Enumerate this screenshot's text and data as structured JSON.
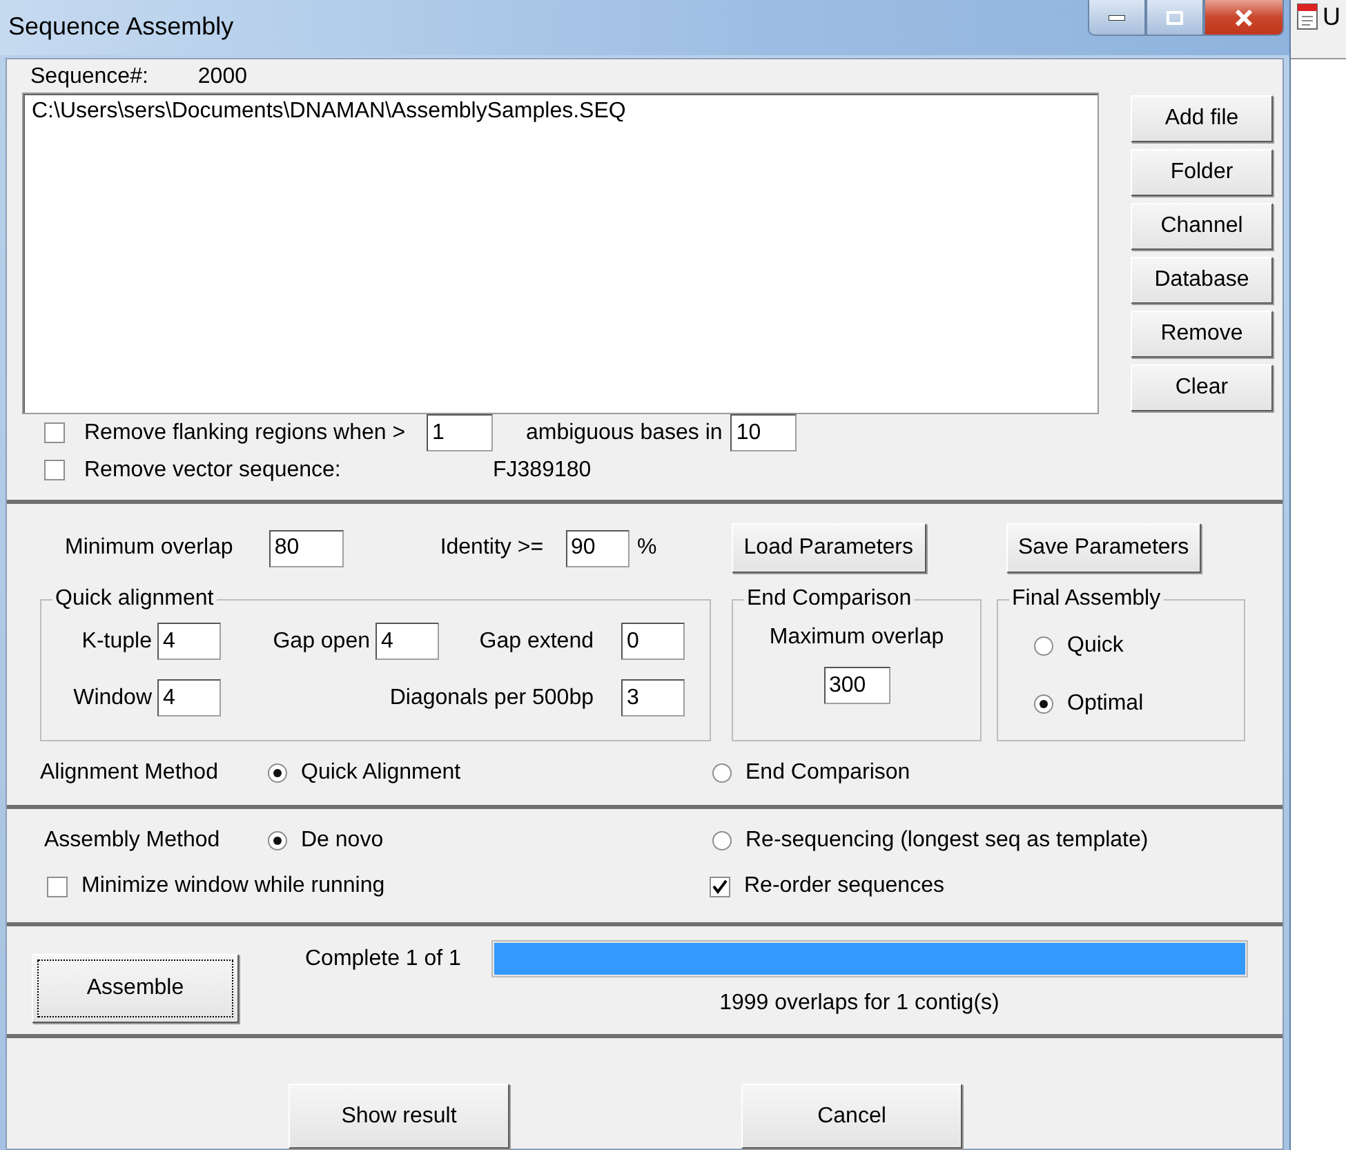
{
  "window": {
    "title": "Sequence Assembly"
  },
  "background_window": {
    "title": "U"
  },
  "sequence": {
    "label": "Sequence#:",
    "value": "2000"
  },
  "file_list": {
    "items": [
      "C:\\Users\\sers\\Documents\\DNAMAN\\AssemblySamples.SEQ"
    ]
  },
  "file_buttons": [
    "Add file",
    "Folder",
    "Channel",
    "Database",
    "Remove",
    "Clear"
  ],
  "trim": [
    {
      "checked": false,
      "label": "Remove flanking regions when >",
      "value": "1",
      "label2": "ambiguous bases in",
      "value2": "10"
    },
    {
      "checked": false,
      "label": "Remove vector sequence:",
      "note": "FJ389180"
    }
  ],
  "parameters": {
    "min_overlap": {
      "label": "Minimum overlap",
      "value": "80"
    },
    "identity": {
      "label": "Identity >=",
      "value": "90",
      "unit": "%"
    },
    "buttons": [
      "Load Parameters",
      "Save Parameters"
    ]
  },
  "quick_alignment": {
    "title": "Quick alignment",
    "fields": [
      {
        "label": "K-tuple",
        "value": "4"
      },
      {
        "label": "Gap open",
        "value": "4"
      },
      {
        "label": "Gap extend",
        "value": "0"
      },
      {
        "label": "Window",
        "value": "4"
      },
      {
        "label": "Diagonals per 500bp",
        "value": "3"
      }
    ]
  },
  "end_comparison": {
    "title": "End Comparison",
    "label": "Maximum overlap",
    "value": "300"
  },
  "final_assembly": {
    "title": "Final Assembly",
    "options": [
      {
        "label": "Quick",
        "selected": false
      },
      {
        "label": "Optimal",
        "selected": true
      }
    ]
  },
  "alignment_method": {
    "label": "Alignment Method",
    "options": [
      {
        "label": "Quick Alignment",
        "selected": true
      },
      {
        "label": "End Comparison",
        "selected": false
      }
    ]
  },
  "assembly_method": {
    "label": "Assembly Method",
    "options": [
      {
        "label": "De novo",
        "selected": true
      },
      {
        "label": "Re-sequencing (longest seq as template)",
        "selected": false
      }
    ]
  },
  "run_options": [
    {
      "label": "Minimize window while running",
      "checked": false
    },
    {
      "label": "Re-order sequences",
      "checked": true
    }
  ],
  "progress": {
    "button": "Assemble",
    "label": "Complete 1 of 1",
    "level": 1,
    "status": "1999 overlaps for 1 contig(s)"
  },
  "buttons": [
    "Show result",
    "Cancel"
  ]
}
